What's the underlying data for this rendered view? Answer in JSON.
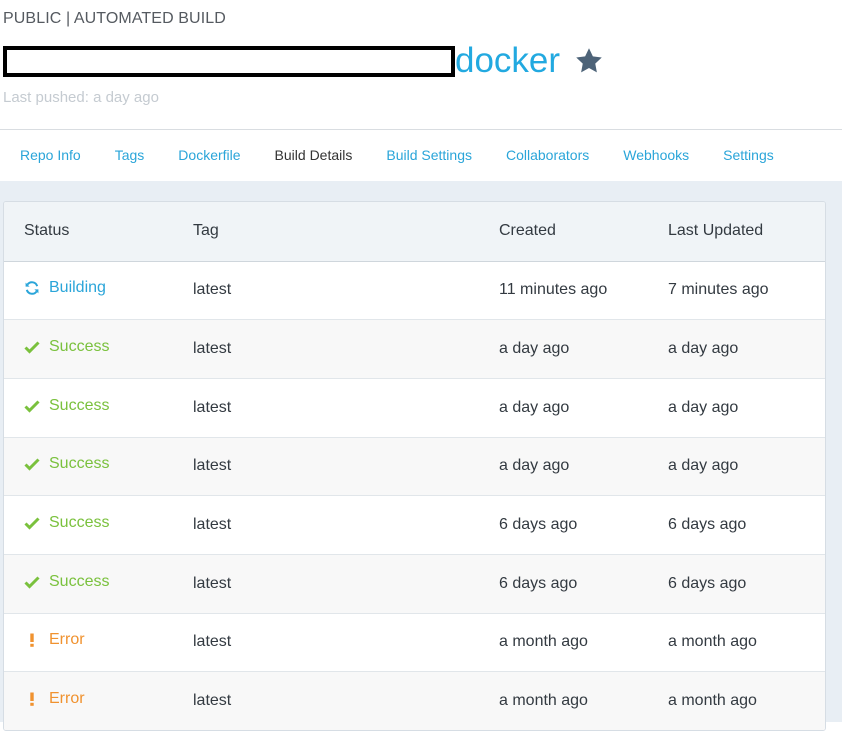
{
  "header": {
    "repo_type": "PUBLIC | AUTOMATED BUILD",
    "repo_name": "docker",
    "last_pushed": "Last pushed: a day ago"
  },
  "tabs": [
    {
      "label": "Repo Info"
    },
    {
      "label": "Tags"
    },
    {
      "label": "Dockerfile"
    },
    {
      "label": "Build Details",
      "active": true
    },
    {
      "label": "Build Settings"
    },
    {
      "label": "Collaborators"
    },
    {
      "label": "Webhooks"
    },
    {
      "label": "Settings"
    }
  ],
  "table": {
    "headers": {
      "status": "Status",
      "tag": "Tag",
      "created": "Created",
      "updated": "Last Updated"
    },
    "rows": [
      {
        "status": "Building",
        "tag": "latest",
        "created": "11 minutes ago",
        "updated": "7 minutes ago"
      },
      {
        "status": "Success",
        "tag": "latest",
        "created": "a day ago",
        "updated": "a day ago"
      },
      {
        "status": "Success",
        "tag": "latest",
        "created": "a day ago",
        "updated": "a day ago"
      },
      {
        "status": "Success",
        "tag": "latest",
        "created": "a day ago",
        "updated": "a day ago"
      },
      {
        "status": "Success",
        "tag": "latest",
        "created": "6 days ago",
        "updated": "6 days ago"
      },
      {
        "status": "Success",
        "tag": "latest",
        "created": "6 days ago",
        "updated": "6 days ago"
      },
      {
        "status": "Error",
        "tag": "latest",
        "created": "a month ago",
        "updated": "a month ago"
      },
      {
        "status": "Error",
        "tag": "latest",
        "created": "a month ago",
        "updated": "a month ago"
      }
    ]
  },
  "icons": {
    "star": "star-icon",
    "building": "refresh-icon",
    "success": "checkmark-icon",
    "error": "exclamation-icon"
  },
  "colors": {
    "accent": "#22a9e0",
    "building": "#2aa5d9",
    "success": "#7ac13d",
    "error": "#f0922f",
    "star": "#4d6378"
  }
}
